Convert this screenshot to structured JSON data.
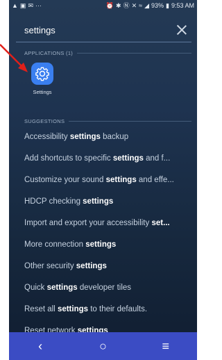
{
  "status_bar": {
    "left_icons": [
      "warning-icon",
      "image-icon",
      "mail-icon",
      "more-icon"
    ],
    "battery": "93%",
    "time": "9:53 AM"
  },
  "search": {
    "query": "settings"
  },
  "applications": {
    "header": "APPLICATIONS (1)",
    "items": [
      {
        "label": "Settings",
        "icon": "gear-icon"
      }
    ]
  },
  "suggestions": {
    "header": "SUGGESTIONS",
    "items": [
      {
        "pre": "Accessibility ",
        "bold": "settings",
        "post": " backup"
      },
      {
        "pre": "Add shortcuts to specific ",
        "bold": "settings",
        "post": " and f..."
      },
      {
        "pre": "Customize your sound ",
        "bold": "settings",
        "post": " and effe..."
      },
      {
        "pre": "HDCP checking ",
        "bold": "settings",
        "post": ""
      },
      {
        "pre": "Import and export your accessibility ",
        "bold": "set...",
        "post": ""
      },
      {
        "pre": "More connection ",
        "bold": "settings",
        "post": ""
      },
      {
        "pre": "Other security ",
        "bold": "settings",
        "post": ""
      },
      {
        "pre": "Quick ",
        "bold": "settings",
        "post": " developer tiles"
      },
      {
        "pre": "Reset all ",
        "bold": "settings",
        "post": " to their defaults."
      },
      {
        "pre": "Reset network ",
        "bold": "settings",
        "post": ""
      }
    ]
  },
  "nav": {
    "back": "‹",
    "home": "○",
    "recents": "≡"
  },
  "colors": {
    "accent": "#3a7ff0",
    "navbar": "#3b4cc4",
    "annotation_arrow": "#e0201a"
  }
}
